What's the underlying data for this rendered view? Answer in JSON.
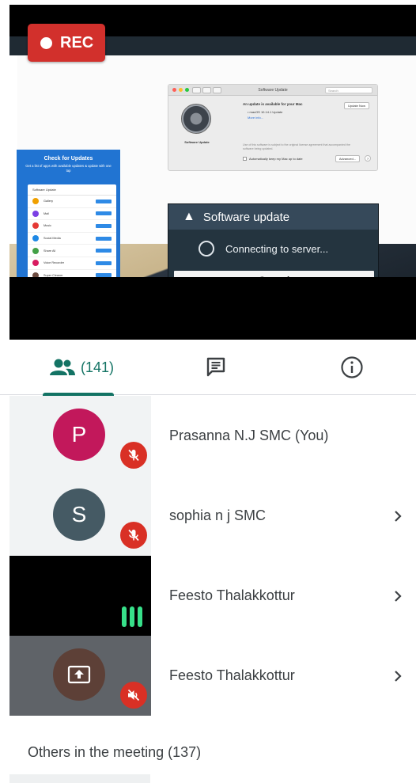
{
  "recording": {
    "label": "REC"
  },
  "shared_screen": {
    "mac_window": {
      "title": "Software Update",
      "search_placeholder": "Search",
      "gear_label": "Software Update",
      "update_text": "An update is available for your Mac",
      "version_text": "• macOS 10.14.1 Update",
      "more_info": "More info...",
      "update_now": "Update Now",
      "terms": "Use of this software is subject to the original license agreement that accompanied the software being updated.",
      "auto_update": "Automatically keep my Mac up to date",
      "advanced": "Advanced...",
      "help": "?"
    },
    "promo": {
      "title": "Check for Updates",
      "subtitle": "Get a list of apps with available updates & update with one tap",
      "screen_header": "Software Update",
      "apps": [
        {
          "name": "Gallery",
          "color": "#f0a000"
        },
        {
          "name": "Mail",
          "color": "#7b3fe4"
        },
        {
          "name": "Music",
          "color": "#e53935"
        },
        {
          "name": "Social Media",
          "color": "#1e88e5"
        },
        {
          "name": "Share All",
          "color": "#43a047"
        },
        {
          "name": "Voice Recorder",
          "color": "#d81b60"
        },
        {
          "name": "Super Cleaner",
          "color": "#6d4c41"
        }
      ]
    },
    "dialog": {
      "title": "Software update",
      "status": "Connecting to server...",
      "cancel": "Cancel"
    }
  },
  "tabs": {
    "people_count": "(141)",
    "active_color": "#137364"
  },
  "participants": [
    {
      "name": "Prasanna N.J SMC (You)",
      "initial": "P",
      "avatar_color": "#c2185b",
      "tile_bg": "#f1f3f4",
      "muted": true
    },
    {
      "name": "sophia n j SMC",
      "initial": "S",
      "avatar_color": "#455a64",
      "tile_bg": "#f1f3f4",
      "muted": true
    },
    {
      "name": "Feesto Thalakkottur",
      "tile_bg": "#000000",
      "speaking": true
    },
    {
      "name": "Feesto Thalakkottur",
      "tile_bg": "#5f6368",
      "presenting": true,
      "muted": true
    }
  ],
  "others_label": "Others in the meeting (137)"
}
